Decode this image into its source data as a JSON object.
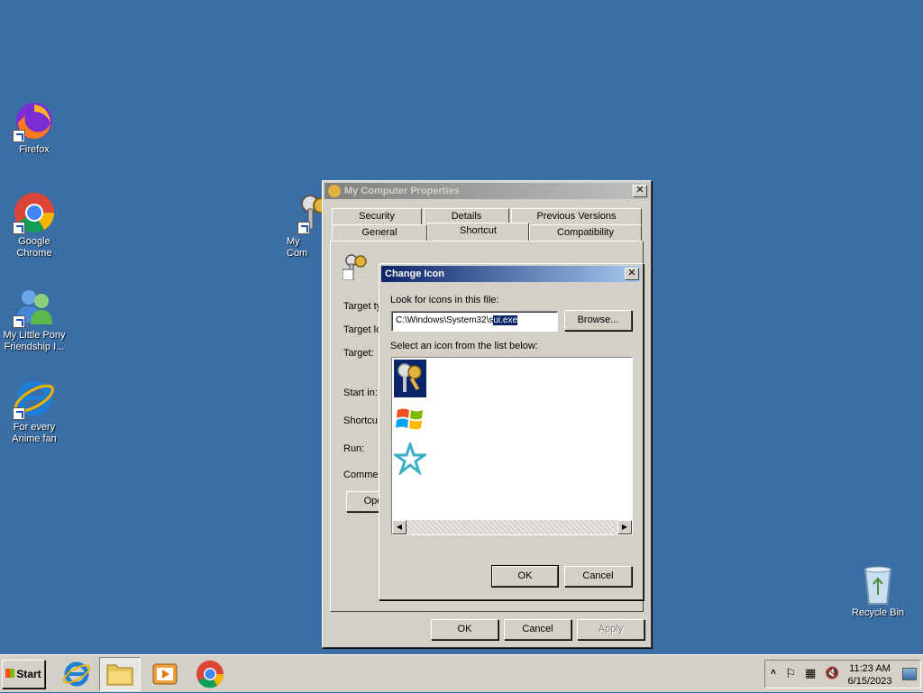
{
  "desktop": {
    "icons": [
      {
        "label": "Firefox"
      },
      {
        "label": "Google Chrome"
      },
      {
        "label": "My Little Pony Friendship I..."
      },
      {
        "label": "For every Anime fan"
      },
      {
        "label": "My Com"
      },
      {
        "label": "Recycle Bin"
      }
    ],
    "background_color": "#3a6ea5"
  },
  "properties_window": {
    "title": "My Computer Properties",
    "tabs_row1": [
      "Security",
      "Details",
      "Previous Versions"
    ],
    "tabs_row2": [
      "General",
      "Shortcut",
      "Compatibility"
    ],
    "active_tab": "Shortcut",
    "field_labels": [
      "Target ty",
      "Target lo",
      "Target:",
      "Start in:",
      "Shortcu",
      "Run:",
      "Commer"
    ],
    "open_button": "Ope",
    "ok": "OK",
    "cancel": "Cancel",
    "apply": "Apply"
  },
  "change_icon_dialog": {
    "title": "Change Icon",
    "look_label": "Look for icons in this file:",
    "path_prefix": "C:\\Windows\\System32\\s",
    "path_selected": "ui.exe",
    "browse": "Browse...",
    "select_label": "Select an icon from the list below:",
    "icons": [
      "keys-icon",
      "windows-flag-icon",
      "star-icon"
    ],
    "ok": "OK",
    "cancel": "Cancel"
  },
  "taskbar": {
    "start": "Start",
    "time": "11:23 AM",
    "date": "6/15/2023"
  }
}
